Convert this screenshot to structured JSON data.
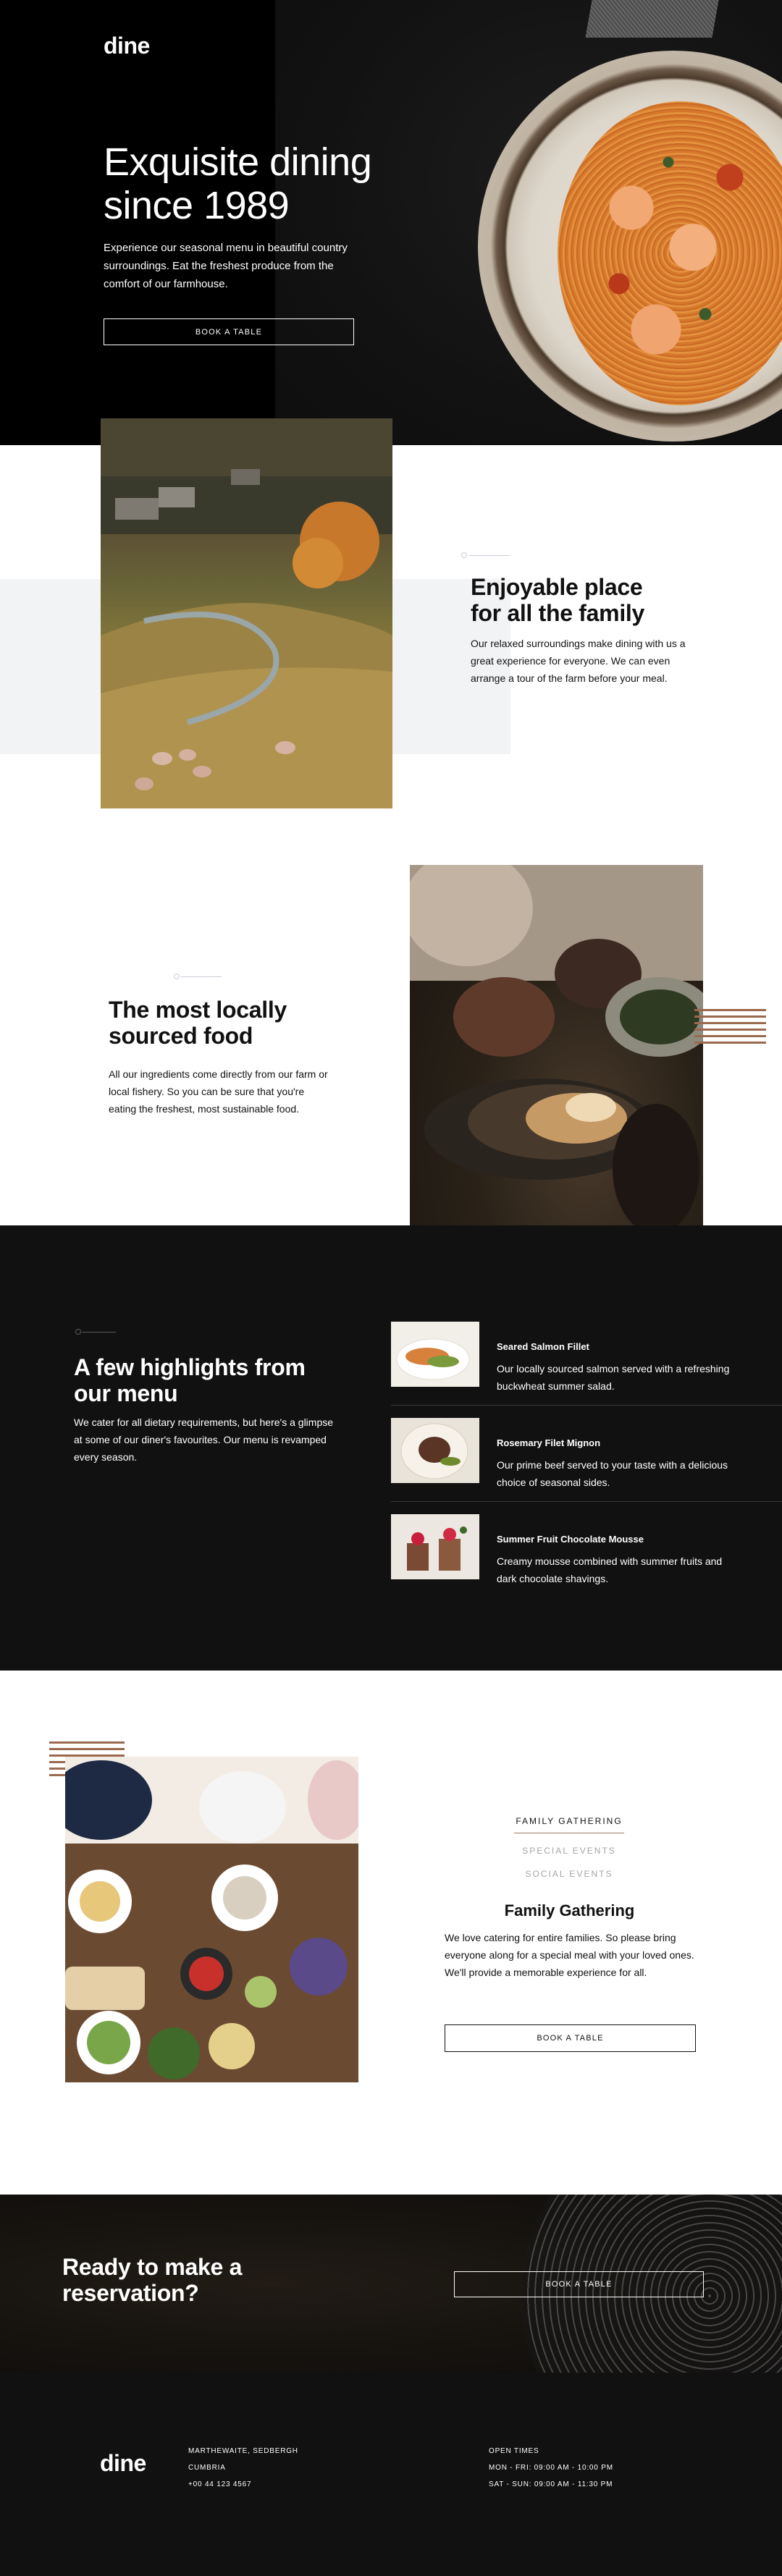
{
  "brand": {
    "logo": "dine"
  },
  "hero": {
    "title_line1": "Exquisite dining",
    "title_line2": "since 1989",
    "body": "Experience our seasonal menu in beautiful country surroundings. Eat the freshest produce from the comfort of our farmhouse.",
    "cta": "BOOK A TABLE"
  },
  "family": {
    "title_line1": "Enjoyable place",
    "title_line2": "for all the family",
    "body": "Our relaxed surroundings make dining with us a great experience for everyone. We can even arrange a tour of the farm before your meal."
  },
  "local": {
    "title_line1": "The most locally",
    "title_line2": "sourced food",
    "body": "All our ingredients come directly from our farm or local fishery. So you can be sure that you're eating the freshest, most sustainable food."
  },
  "highlights": {
    "title_line1": "A few highlights from",
    "title_line2": "our menu",
    "body": "We cater for all dietary requirements, but here's a glimpse at some of our diner's favourites. Our menu is revamped every season.",
    "items": [
      {
        "title": "Seared Salmon Fillet",
        "desc": "Our locally sourced salmon served with a refreshing buckwheat summer salad."
      },
      {
        "title": "Rosemary Filet Mignon",
        "desc": "Our prime beef served to your taste with a delicious choice of seasonal sides."
      },
      {
        "title": "Summer Fruit Chocolate Mousse",
        "desc": "Creamy mousse combined with summer fruits and dark chocolate shavings."
      }
    ]
  },
  "events": {
    "tabs": [
      "FAMILY GATHERING",
      "SPECIAL EVENTS",
      "SOCIAL EVENTS"
    ],
    "active_tab": 0,
    "title": "Family Gathering",
    "body": "We love catering for entire families. So please bring everyone along for a special meal with your loved ones. We'll provide a memorable experience for all.",
    "cta": "BOOK A TABLE"
  },
  "reservation": {
    "title_line1": "Ready to make a",
    "title_line2": "reservation?",
    "cta": "BOOK A TABLE"
  },
  "footer": {
    "logo": "dine",
    "address_line1": "MARTHEWAITE, SEDBERGH",
    "address_line2": "CUMBRIA",
    "phone": "+00 44 123 4567",
    "hours_title": "OPEN TIMES",
    "hours_weekday": "MON - FRI: 09:00 AM - 10:00 PM",
    "hours_weekend": "SAT - SUN: 09:00 AM - 11:30 PM"
  },
  "colors": {
    "dark": "#111111",
    "accent": "#9e7f66",
    "grey_band": "#f2f3f5"
  }
}
